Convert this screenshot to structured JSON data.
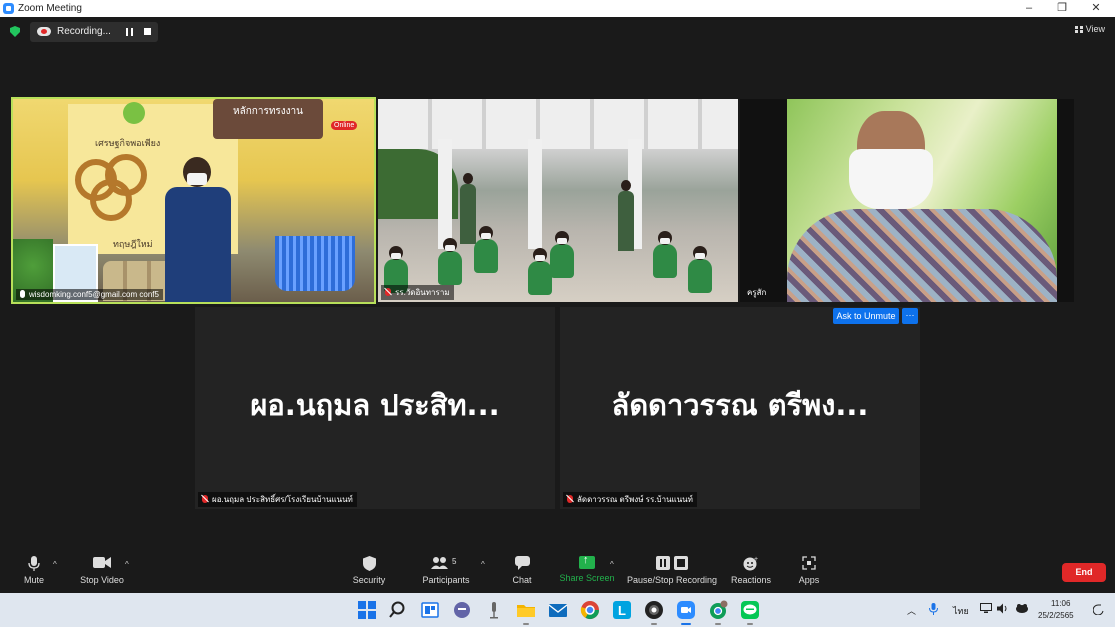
{
  "window": {
    "title": "Zoom Meeting",
    "minimize": "–",
    "maximize": "❐",
    "close": "✕"
  },
  "meeting": {
    "recording_label": "Recording...",
    "view_label": "View",
    "tiles": [
      {
        "name": "wisdomking.conf5@gmail.com conf5",
        "muted": false
      },
      {
        "name": "รร.วัดอินทาราม",
        "muted": true
      },
      {
        "name": "ครูสัก",
        "muted": false
      },
      {
        "name": "ผอ.นฤมล ประสิทธิ์ศร/โรงเรียนบ้านแนนท์",
        "display_name": "ผอ.นฤมล ประสิท...",
        "muted": true
      },
      {
        "name": "ลัดดาวรรณ ตรีพงษ์ รร.บ้านแนนท์",
        "display_name": "ลัดดาวรรณ ตรีพง...",
        "muted": true
      }
    ],
    "poster": {
      "headline": "หลักการทรงงาน",
      "title": "เศรษฐกิจพอเพียง",
      "title2": "ทฤษฎีใหม่",
      "badge": "Online"
    },
    "ask_to_unmute": "Ask to Unmute",
    "more": "···"
  },
  "controls": {
    "mute": "Mute",
    "stop_video": "Stop Video",
    "security": "Security",
    "participants": "Participants",
    "participants_count": "5",
    "chat": "Chat",
    "share_screen": "Share Screen",
    "pause_stop_recording": "Pause/Stop Recording",
    "reactions": "Reactions",
    "apps": "Apps",
    "end": "End",
    "colors": {
      "share": "#22b14c",
      "end": "#e02828",
      "unmute": "#0e72ed"
    }
  },
  "taskbar": {
    "language": "ไทย",
    "time": "11:06",
    "date": "25/2/2565"
  }
}
